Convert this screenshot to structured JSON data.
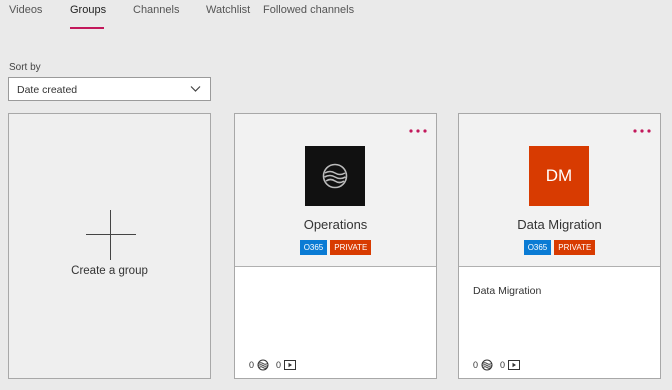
{
  "tabs": [
    {
      "label": "Videos"
    },
    {
      "label": "Groups"
    },
    {
      "label": "Channels"
    },
    {
      "label": "Watchlist"
    },
    {
      "label": "Followed channels"
    }
  ],
  "active_tab": "Groups",
  "sort": {
    "label": "Sort by",
    "value": "Date created"
  },
  "create_card": {
    "label": "Create a group"
  },
  "groups": [
    {
      "name": "Operations",
      "avatar_icon": "wave-globe-icon",
      "avatar_color": "#111111",
      "badges": [
        "O365",
        "PRIVATE"
      ],
      "description": "",
      "members_count": "0",
      "videos_count": "0"
    },
    {
      "name": "Data Migration",
      "avatar_text": "DM",
      "avatar_color": "#d83b01",
      "badges": [
        "O365",
        "PRIVATE"
      ],
      "description": "Data Migration",
      "members_count": "0",
      "videos_count": "0"
    }
  ],
  "colors": {
    "accent": "#c2185b",
    "o365": "#0a7bd4",
    "private": "#d83b01"
  }
}
